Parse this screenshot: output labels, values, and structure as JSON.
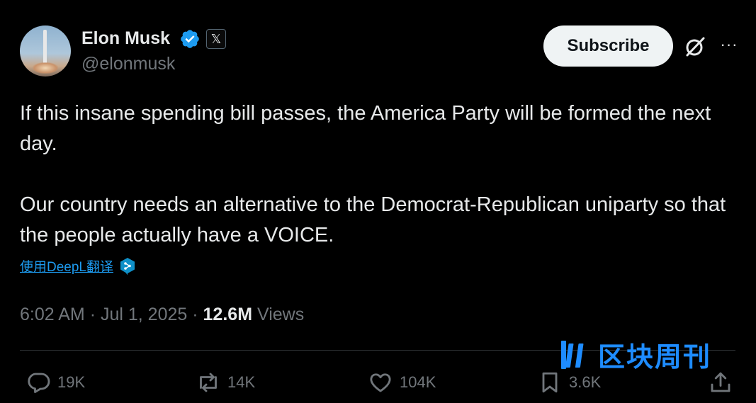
{
  "author": {
    "name": "Elon Musk",
    "handle": "@elonmusk",
    "verified_icon": "verified-badge-icon",
    "affiliation_badge": "𝕏"
  },
  "header": {
    "subscribe_label": "Subscribe",
    "grok_icon": "grok-icon",
    "more_icon": "more-icon",
    "more_glyph": "···"
  },
  "tweet": {
    "paragraphs": [
      "If this insane spending bill passes, the America Party will be formed the next day.",
      "Our country needs an alternative to the Democrat-Republican uniparty so that the people actually have a VOICE."
    ],
    "translate_label": "使用DeepL翻译"
  },
  "meta": {
    "time": "6:02 AM",
    "separator": "·",
    "date": "Jul 1, 2025",
    "views_count": "12.6M",
    "views_label": "Views"
  },
  "actions": {
    "replies": "19K",
    "reposts": "14K",
    "likes": "104K",
    "bookmarks": "3.6K"
  },
  "watermark": {
    "text": "区块周刊"
  },
  "colors": {
    "background": "#000000",
    "text": "#e7e9ea",
    "secondary": "#71767b",
    "accent": "#1d9bf0",
    "watermark": "#1e8cff"
  }
}
